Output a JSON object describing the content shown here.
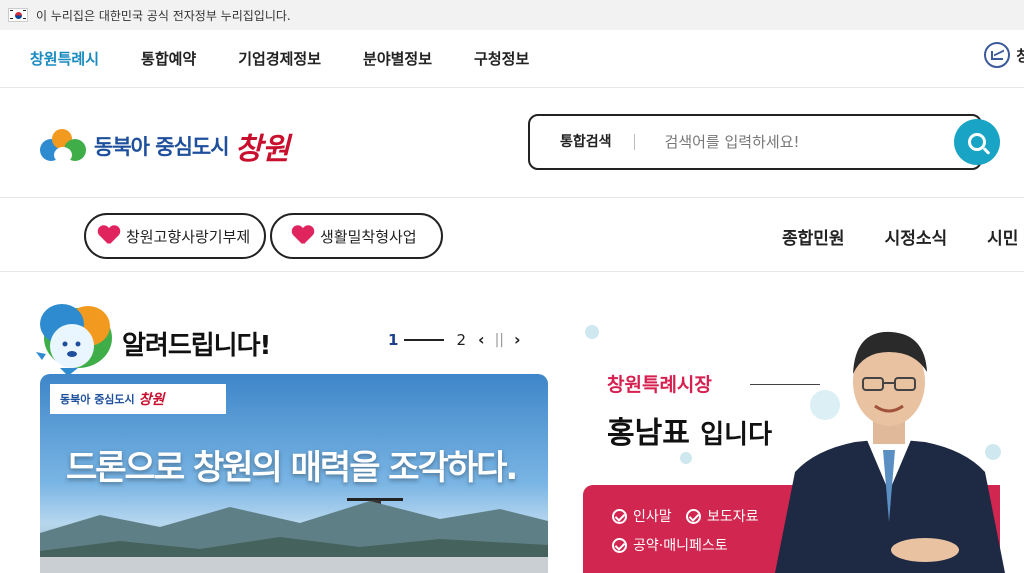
{
  "gov_banner": {
    "text": "이 누리집은 대한민국 공식 전자정부 누리집입니다."
  },
  "top_nav": {
    "items": [
      "창원특례시",
      "통합예약",
      "기업경제정보",
      "분야별정보",
      "구청정보"
    ],
    "right_label": "창원"
  },
  "header": {
    "logo_text": "동북아 중심도시",
    "logo_script": "창원",
    "search": {
      "label": "통합검색",
      "placeholder": "검색어를 입력하세요!"
    }
  },
  "pills": [
    "창원고향사랑기부제",
    "생활밀착형사업"
  ],
  "main_nav": [
    "종합민원",
    "시정소식",
    "시민"
  ],
  "notice": {
    "title": "알려드립니다!",
    "pager": {
      "current": "1",
      "total": "2",
      "prev": "‹",
      "pause": "||",
      "next": "›"
    },
    "banner": {
      "badge_text": "동북아 중심도시",
      "badge_script": "창원",
      "headline": "드론으로 창원의 매력을 조각하다."
    }
  },
  "mayor": {
    "title": "창원특례시장",
    "name": "홍남표",
    "name_suffix": "입니다",
    "links": [
      "인사말",
      "보도자료",
      "공약·매니페스토"
    ]
  },
  "colors": {
    "accent": "#1a8bbf",
    "search_btn": "#19a4c6",
    "brand_red": "#d02650",
    "brand_blue": "#1d4f9c"
  }
}
